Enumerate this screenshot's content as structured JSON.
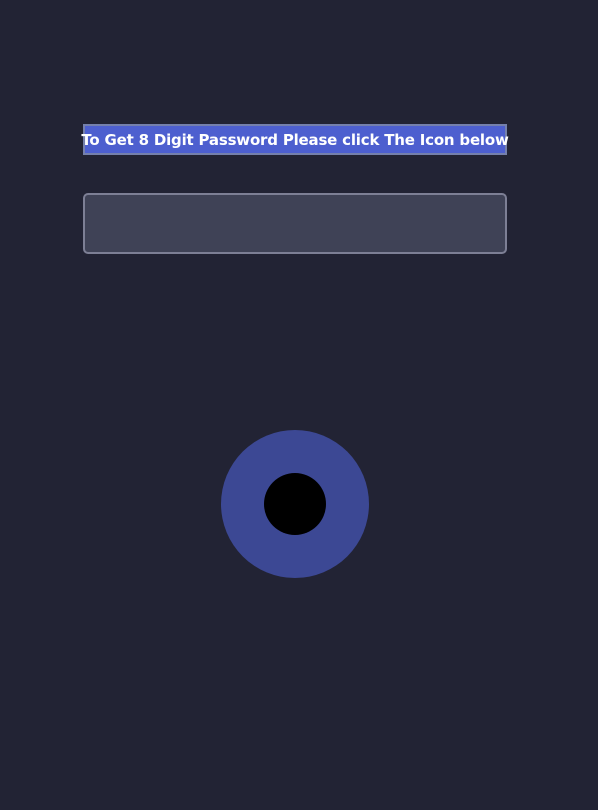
{
  "instruction": {
    "text": "To Get 8 Digit Password Please click The Icon below"
  },
  "password_field": {
    "value": "",
    "placeholder": ""
  },
  "generate_button": {
    "icon": "circle-icon"
  },
  "colors": {
    "background": "#222334",
    "banner": "#4d5fcf",
    "field": "#3f4256",
    "button": "#3c4894",
    "button_center": "#000000"
  }
}
